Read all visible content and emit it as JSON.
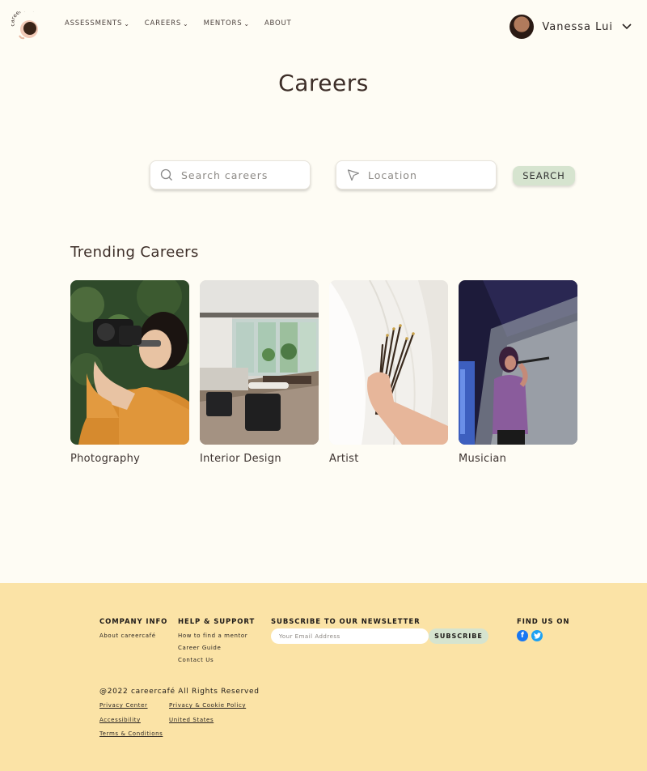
{
  "brand": {
    "logo_text": "career café"
  },
  "nav": [
    {
      "label": "ASSESSMENTS",
      "dropdown": true
    },
    {
      "label": "CAREERS",
      "dropdown": true
    },
    {
      "label": "MENTORS",
      "dropdown": true
    },
    {
      "label": "ABOUT",
      "dropdown": false
    }
  ],
  "user": {
    "name": "Vanessa Lui"
  },
  "page": {
    "title": "Careers"
  },
  "search": {
    "careers_placeholder": "Search careers",
    "location_placeholder": "Location",
    "button_label": "SEARCH"
  },
  "trending": {
    "title": "Trending Careers",
    "cards": [
      {
        "label": "Photography"
      },
      {
        "label": "Interior Design"
      },
      {
        "label": "Artist"
      },
      {
        "label": "Musician"
      }
    ]
  },
  "footer": {
    "company_info": {
      "title": "COMPANY INFO",
      "links": [
        "About careercafé"
      ]
    },
    "help": {
      "title": "HELP & SUPPORT",
      "links": [
        "How to find a mentor",
        "Career Guide",
        "Contact Us"
      ]
    },
    "newsletter": {
      "title": "SUBSCRIBE TO OUR NEWSLETTER",
      "placeholder": "Your Email Address",
      "button": "SUBSCRIBE"
    },
    "social": {
      "title": "FIND US ON",
      "icons": [
        "facebook-icon",
        "twitter-icon"
      ]
    },
    "copyright": "@2022 careercafé All Rights Reserved",
    "legal": [
      "Privacy Center",
      "Privacy & Cookie Policy",
      "Accessibility",
      "United States",
      "Terms & Conditions"
    ]
  },
  "colors": {
    "background": "#fefcf4",
    "footer": "#fbe3a6",
    "accent_button": "#d6e4cf",
    "text": "#3d2e28"
  }
}
